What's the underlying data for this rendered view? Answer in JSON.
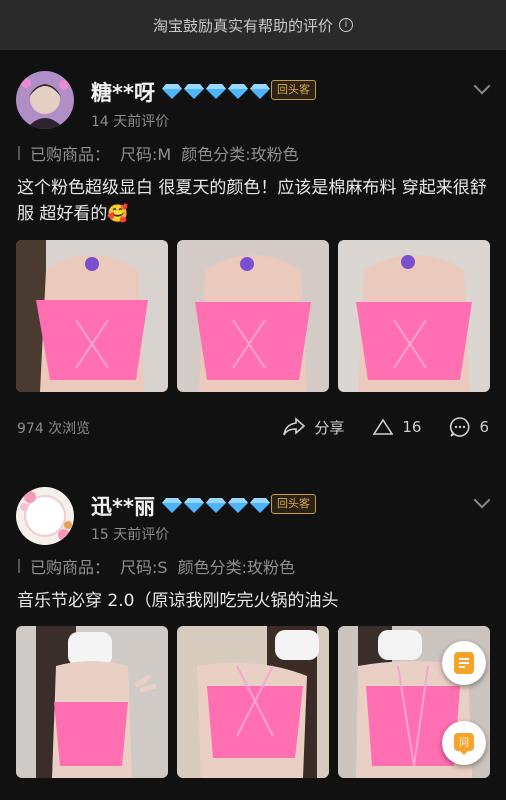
{
  "banner": {
    "text": "淘宝鼓励真实有帮助的评价",
    "icon": "info-icon"
  },
  "colors": {
    "accent_pink": "#ff5fa8",
    "badge_gold": "#d9a648",
    "diamond_blue": "#4db4ff"
  },
  "reviews": [
    {
      "name": "糖**呀",
      "badge": "回头客",
      "date": "14 天前评价",
      "purchase_label": "已购商品：",
      "size": "尺码:M",
      "color": "颜色分类:玫粉色",
      "content": "这个粉色超级显白 很夏天的颜色！应该是棉麻布料 穿起来很舒服 超好看的🥰",
      "views": "974 次浏览",
      "share_label": "分享",
      "likes": "16",
      "comments": "6"
    },
    {
      "name": "迅**丽",
      "badge": "回头客",
      "date": "15 天前评价",
      "purchase_label": "已购商品：",
      "size": "尺码:S",
      "color": "颜色分类:玫粉色",
      "content": "音乐节必穿 2.0（原谅我刚吃完火锅的油头"
    }
  ]
}
